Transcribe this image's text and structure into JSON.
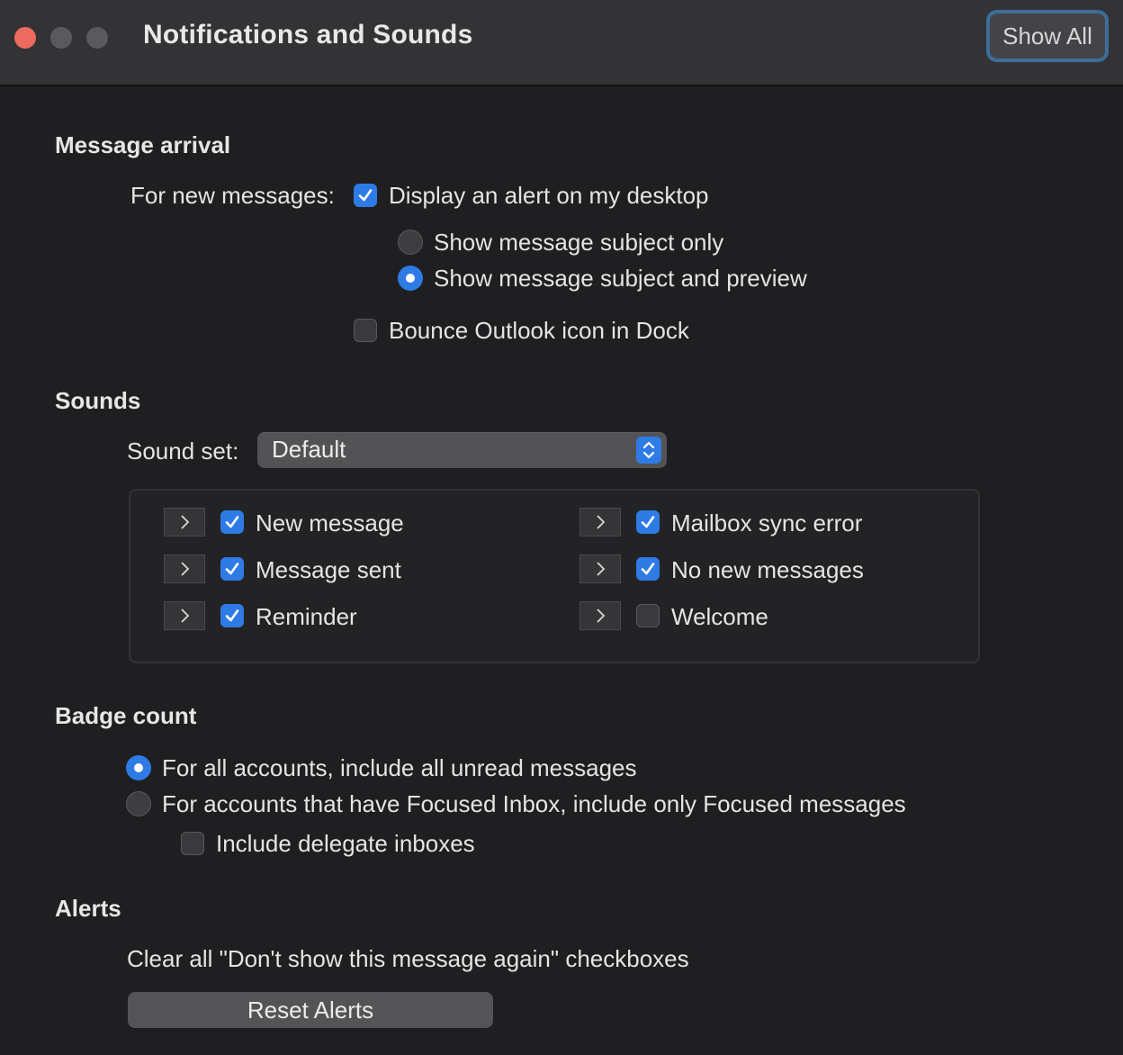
{
  "window": {
    "title": "Notifications and Sounds",
    "show_all_label": "Show All",
    "close_color": "#ed6a5e"
  },
  "accent": "#2f7be6",
  "message_arrival": {
    "heading": "Message arrival",
    "for_new_label": "For new messages:",
    "display_alert": {
      "label": "Display an alert on my desktop",
      "checked": true
    },
    "options": [
      {
        "label": "Show message subject only",
        "selected": false
      },
      {
        "label": "Show message subject and preview",
        "selected": true
      }
    ],
    "bounce": {
      "label": "Bounce Outlook icon in Dock",
      "checked": false
    }
  },
  "sounds": {
    "heading": "Sounds",
    "sound_set_label": "Sound set:",
    "sound_set_value": "Default",
    "items": [
      {
        "label": "New message",
        "checked": true
      },
      {
        "label": "Message sent",
        "checked": true
      },
      {
        "label": "Reminder",
        "checked": true
      },
      {
        "label": "Mailbox sync error",
        "checked": true
      },
      {
        "label": "No new messages",
        "checked": true
      },
      {
        "label": "Welcome",
        "checked": false
      }
    ]
  },
  "badge_count": {
    "heading": "Badge count",
    "options": [
      {
        "label": "For all accounts, include all unread messages",
        "selected": true
      },
      {
        "label": "For accounts that have Focused Inbox, include only Focused messages",
        "selected": false
      }
    ],
    "delegate": {
      "label": "Include delegate inboxes",
      "checked": false
    }
  },
  "alerts": {
    "heading": "Alerts",
    "description": "Clear all \"Don't show this message again\" checkboxes",
    "reset_label": "Reset Alerts"
  }
}
